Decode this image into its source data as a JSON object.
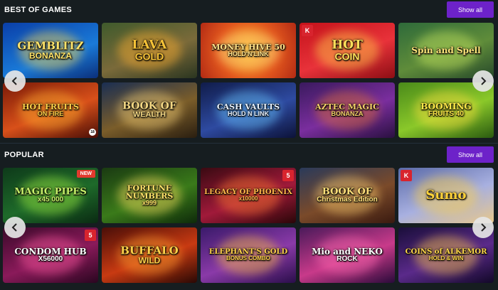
{
  "colors": {
    "background": "#161d20",
    "accent": "#6d22c9"
  },
  "sections": [
    {
      "title": "BEST OF GAMES",
      "show_all_label": "Show all",
      "games": [
        {
          "title": "GEMBLITZ",
          "sub": "BONANZA",
          "bg": "linear-gradient(160deg,#0a3fa8,#1a7ad8 60%,#0b2f7a)",
          "glow": "#ffd84a",
          "color": "#ffe46a",
          "size": 15
        },
        {
          "title": "LAVA",
          "sub": "GOLD",
          "bg": "linear-gradient(160deg,#3f5a2c,#7a6a3a 55%,#2a3520)",
          "glow": "#ffb030",
          "color": "#f6c338",
          "size": 17
        },
        {
          "title": "MONEY HIVE 50",
          "sub": "HOLD'N'LINK",
          "bg": "radial-gradient(circle at 50% 50%,#ffb428,#e2571e 55%,#b22a14)",
          "glow": "#ffe080",
          "color": "#ffe28a",
          "size": 11
        },
        {
          "title": "HOT",
          "sub": "COIN",
          "bg": "linear-gradient(160deg,#c4121a,#e8323a 55%,#8d0e14)",
          "glow": "#ffd24a",
          "color": "#ffe05a",
          "size": 17,
          "provider": "K"
        },
        {
          "title": "Spin and Spell",
          "sub": "",
          "bg": "linear-gradient(160deg,#2e6a3a,#5f8c3a 55%,#26482a)",
          "glow": "#c8e860",
          "color": "#ffe37a",
          "size": 12
        },
        {
          "title": "HOT FRUITS",
          "sub": "ON FIRE",
          "bg": "linear-gradient(160deg,#7a1a08,#d8501a 55%,#4a0e06)",
          "glow": "#ffb030",
          "color": "#ffd24a",
          "size": 11,
          "age": true
        },
        {
          "title": "BOOK OF",
          "sub": "WEALTH",
          "bg": "linear-gradient(160deg,#1a2e52,#7a5d2a 55%,#2a1e10)",
          "glow": "#f6d27a",
          "color": "#f3d784",
          "size": 14
        },
        {
          "title": "CASH VAULTS",
          "sub": "HOLD N LINK",
          "bg": "linear-gradient(160deg,#101c4a,#2e4aa0 55%,#0c1238)",
          "glow": "#6ac8ff",
          "color": "#e8f2ff",
          "size": 11
        },
        {
          "title": "AZTEC MAGIC",
          "sub": "BONANZA",
          "bg": "linear-gradient(160deg,#3a1a5e,#7a2e9e 55%,#2a1040)",
          "glow": "#e07030",
          "color": "#f6d26a",
          "size": 11
        },
        {
          "title": "BOOMING",
          "sub": "FRUITS 40",
          "bg": "linear-gradient(160deg,#4a8a1a,#8ac82a 55%,#2a5a10)",
          "glow": "#ffe040",
          "color": "#ffe84a",
          "size": 12
        }
      ]
    },
    {
      "title": "POPULAR",
      "show_all_label": "Show all",
      "games": [
        {
          "title": "MAGIC PIPES",
          "sub": "x45 000",
          "bg": "linear-gradient(160deg,#0e3a1a,#1e6a2a 55%,#0a2a12)",
          "glow": "#a0f040",
          "color": "#c8f06a",
          "size": 13,
          "badge": "NEW"
        },
        {
          "title": "FORTUNE NUMBERS",
          "sub": "x999",
          "bg": "linear-gradient(160deg,#1a3a12,#3a7a1a 55%,#0e2a0a)",
          "glow": "#ffe060",
          "color": "#ffe26a",
          "size": 11
        },
        {
          "title": "LEGACY OF PHOENIX",
          "sub": "x10000",
          "bg": "linear-gradient(160deg,#3a0a12,#a01a3a 55%,#2a0608)",
          "glow": "#ff7a30",
          "color": "#ffb84a",
          "size": 10,
          "provider": "5",
          "provider_right": true
        },
        {
          "title": "BOOK OF",
          "sub": "Christmas Edition",
          "bg": "linear-gradient(160deg,#2a3a5a,#7a4a2a 55%,#3a1a10)",
          "glow": "#ffd070",
          "color": "#ffe07a",
          "size": 13
        },
        {
          "title": "Sumo",
          "sub": "",
          "bg": "linear-gradient(160deg,#5a6aa8,#a8b0e0 55%,#e8c88a)",
          "glow": "#ffd040",
          "color": "#ffd23a",
          "size": 18,
          "provider": "K"
        },
        {
          "title": "CONDOM HUB",
          "sub": "X56000",
          "bg": "linear-gradient(160deg,#3a0a2a,#8a1a5a 55%,#2a0620)",
          "glow": "#ff5aa0",
          "color": "#ffffff",
          "size": 12,
          "provider": "5",
          "provider_right": true
        },
        {
          "title": "BUFFALO",
          "sub": "WILD",
          "bg": "linear-gradient(160deg,#4a0e08,#c83a12 55%,#2a0804)",
          "glow": "#ffa030",
          "color": "#ffd24a",
          "size": 15
        },
        {
          "title": "ELEPHANT'S GOLD",
          "sub": "BONUS COMBO",
          "bg": "linear-gradient(160deg,#3a1a6a,#8a3aa8 55%,#2a0e4a)",
          "glow": "#ffc040",
          "color": "#ffd24a",
          "size": 10
        },
        {
          "title": "Mio and NEKO",
          "sub": "ROCK",
          "bg": "linear-gradient(160deg,#4a1a5a,#c83a8a 55%,#2a0a3a)",
          "glow": "#ff6ab0",
          "color": "#ffffff",
          "size": 12
        },
        {
          "title": "COINS of ALKEMOR",
          "sub": "HOLD & WIN",
          "bg": "linear-gradient(160deg,#1a0e3a,#5a2a8a 55%,#120828)",
          "glow": "#ffc84a",
          "color": "#ffd84a",
          "size": 10
        }
      ]
    }
  ]
}
